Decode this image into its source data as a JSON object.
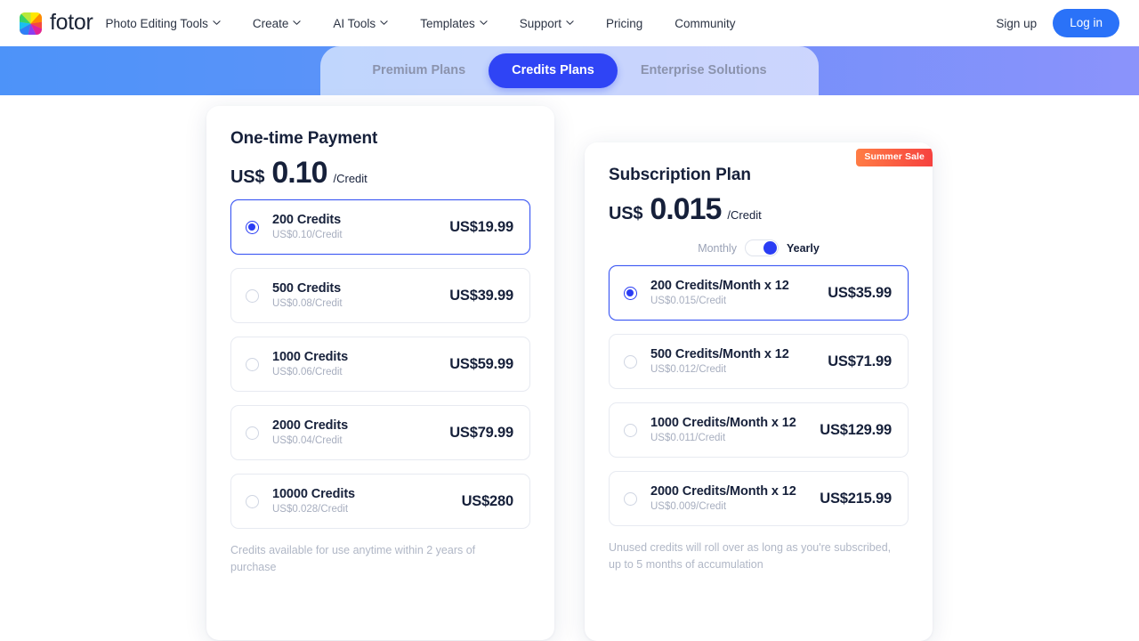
{
  "brand": {
    "name": "fotor",
    "logo_icon": "color-wheel-logo-icon"
  },
  "nav": {
    "items": [
      {
        "label": "Photo Editing Tools",
        "has_caret": true
      },
      {
        "label": "Create",
        "has_caret": true
      },
      {
        "label": "AI Tools",
        "has_caret": true
      },
      {
        "label": "Templates",
        "has_caret": true
      },
      {
        "label": "Support",
        "has_caret": true
      },
      {
        "label": "Pricing",
        "has_caret": false
      },
      {
        "label": "Community",
        "has_caret": false
      }
    ],
    "signup_label": "Sign up",
    "login_label": "Log in",
    "login_color": "#2a72f8"
  },
  "banner": {
    "gradient_from": "#4d93f9",
    "gradient_to": "#8b93fb",
    "tabs": [
      {
        "label": "Premium Plans",
        "active": false
      },
      {
        "label": "Credits Plans",
        "active": true
      },
      {
        "label": "Enterprise Solutions",
        "active": false
      }
    ],
    "active_tab_color": "#2f44f5"
  },
  "onetime_card": {
    "title": "One-time Payment",
    "currency": "US$",
    "amount": "0.10",
    "unit": "/Credit",
    "options": [
      {
        "name": "200 Credits",
        "rate": "US$0.10/Credit",
        "price": "US$19.99",
        "selected": true
      },
      {
        "name": "500 Credits",
        "rate": "US$0.08/Credit",
        "price": "US$39.99",
        "selected": false
      },
      {
        "name": "1000 Credits",
        "rate": "US$0.06/Credit",
        "price": "US$59.99",
        "selected": false
      },
      {
        "name": "2000 Credits",
        "rate": "US$0.04/Credit",
        "price": "US$79.99",
        "selected": false
      },
      {
        "name": "10000 Credits",
        "rate": "US$0.028/Credit",
        "price": "US$280",
        "selected": false
      }
    ],
    "footnote": "Credits available for use anytime within 2 years of purchase"
  },
  "subscription_card": {
    "badge": "Summer Sale",
    "badge_gradient_from": "#ff7d45",
    "badge_gradient_to": "#f6413f",
    "title": "Subscription Plan",
    "currency": "US$",
    "amount": "0.015",
    "unit": "/Credit",
    "billing_toggle": {
      "left_label": "Monthly",
      "right_label": "Yearly",
      "selected": "Yearly"
    },
    "options": [
      {
        "name": "200 Credits/Month x 12",
        "rate": "US$0.015/Credit",
        "price": "US$35.99",
        "selected": true
      },
      {
        "name": "500 Credits/Month x 12",
        "rate": "US$0.012/Credit",
        "price": "US$71.99",
        "selected": false
      },
      {
        "name": "1000 Credits/Month x 12",
        "rate": "US$0.011/Credit",
        "price": "US$129.99",
        "selected": false
      },
      {
        "name": "2000 Credits/Month x 12",
        "rate": "US$0.009/Credit",
        "price": "US$215.99",
        "selected": false
      }
    ],
    "footnote": "Unused credits will roll over as long as you're subscribed, up to 5 months of accumulation"
  }
}
